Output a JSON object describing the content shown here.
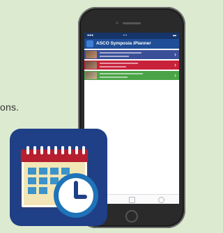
{
  "page": {
    "text_fragment": "ons."
  },
  "phone": {
    "app_title": "ASCO Symposia iPlanner",
    "app_logo": "ASCO"
  },
  "icon": {
    "name": "calendar-clock-icon"
  }
}
